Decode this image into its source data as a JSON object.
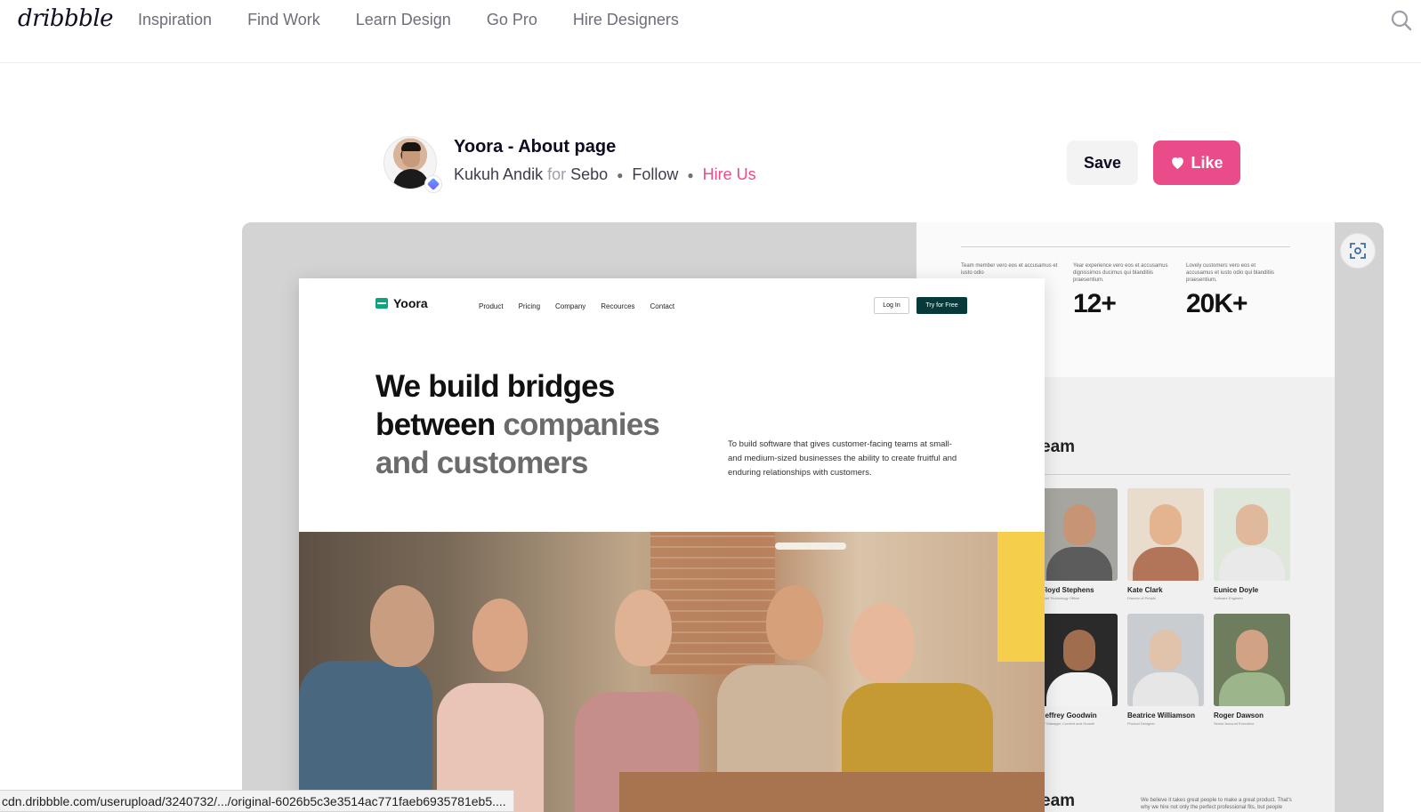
{
  "app": {
    "logo": "dribbble"
  },
  "nav": {
    "items": [
      "Inspiration",
      "Find Work",
      "Learn Design",
      "Go Pro",
      "Hire Designers"
    ],
    "search_icon": "search-icon"
  },
  "shot": {
    "title": "Yoora - About page",
    "author": "Kukuh Andik",
    "for_label": "for",
    "team": "Sebo",
    "follow": "Follow",
    "hire": "Hire Us",
    "save": "Save",
    "like": "Like",
    "colors": {
      "accent": "#ea4c89",
      "save_bg": "#f3f3f4"
    }
  },
  "mockup": {
    "brand": "Yoora",
    "menu": [
      "Product",
      "Pricing",
      "Company",
      "Recources",
      "Contact"
    ],
    "login": "Log In",
    "try": "Try for Free",
    "headline_line1": "We build bridges",
    "headline_line2_dark": "between",
    "headline_line2_grey": "companies",
    "headline_line3_grey": "and customers",
    "subtext": "To build software that gives customer-facing teams at small- and medium-sized businesses the ability to create fruitful and enduring relationships with customers."
  },
  "side_page": {
    "stats": [
      {
        "caption": "Team member vero eos et accusamus et iusto odio",
        "value": ""
      },
      {
        "caption": "Year experience vero eos et accusamus dignissimos ducimus qui blanditiis praesentium.",
        "value": "12+"
      },
      {
        "caption": "Lovely customers vero eos et accusamus et iusto odio qui blanditiis praesentium.",
        "value": "20K+"
      }
    ],
    "team_title": "eam",
    "team": [
      {
        "name": "Floyd Stephens",
        "role": "Chief Technology Officer"
      },
      {
        "name": "Kate Clark",
        "role": "Director of People"
      },
      {
        "name": "Eunice Doyle",
        "role": "Software Engineer"
      },
      {
        "name": "Jeffrey Goodwin",
        "role": "VP Manager, Content and Growth"
      },
      {
        "name": "Beatrice Williamson",
        "role": "Product Designer"
      },
      {
        "name": "Roger Dawson",
        "role": "Senior Account Executive"
      }
    ],
    "team_title2": "eam",
    "blurb": "We believe it takes great people to make a great product. That's why we hire not only the perfect professional fits, but people who embody"
  },
  "status_bar": {
    "url": "cdn.dribbble.com/userupload/3240732/.../original-6026b5c3e3514ac771faeb6935781eb5...."
  }
}
